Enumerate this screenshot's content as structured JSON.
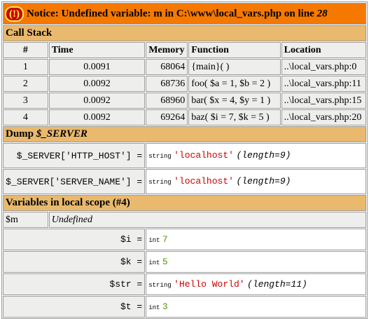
{
  "notice": {
    "icon": "(!)",
    "label": "Notice: Undefined variable: m in C:\\www\\local_vars.php on line ",
    "line": "28"
  },
  "call_stack": {
    "title": "Call Stack",
    "headers": [
      "#",
      "Time",
      "Memory",
      "Function",
      "Location"
    ],
    "rows": [
      {
        "n": "1",
        "time": "0.0091",
        "memory": "68064",
        "func": "{main}( )",
        "loc": "..\\local_vars.php:0"
      },
      {
        "n": "2",
        "time": "0.0092",
        "memory": "68736",
        "func": "foo( $a = 1, $b = 2 )",
        "loc": "..\\local_vars.php:11"
      },
      {
        "n": "3",
        "time": "0.0092",
        "memory": "68960",
        "func": "bar( $x = 4, $y = 1 )",
        "loc": "..\\local_vars.php:15"
      },
      {
        "n": "4",
        "time": "0.0092",
        "memory": "69264",
        "func": "baz( $i = 7, $k = 5 )",
        "loc": "..\\local_vars.php:20"
      }
    ]
  },
  "dump": {
    "title_prefix": "Dump ",
    "title_var": "$_SERVER",
    "rows": [
      {
        "key": "$_SERVER['HTTP_HOST'] =",
        "type": "string",
        "value": "'localhost'",
        "len": "(length=9)"
      },
      {
        "key": "$_SERVER['SERVER_NAME'] =",
        "type": "string",
        "value": "'localhost'",
        "len": "(length=9)"
      }
    ]
  },
  "locals": {
    "title": "Variables in local scope (#4)",
    "undefined": {
      "name": "$m",
      "value": "Undefined"
    },
    "rows": [
      {
        "key": "$i =",
        "type": "int",
        "value": "7",
        "len": ""
      },
      {
        "key": "$k =",
        "type": "int",
        "value": "5",
        "len": ""
      },
      {
        "key": "$str =",
        "type": "string",
        "value": "'Hello World'",
        "len": "(length=11)"
      },
      {
        "key": "$t =",
        "type": "int",
        "value": "3",
        "len": ""
      }
    ]
  }
}
